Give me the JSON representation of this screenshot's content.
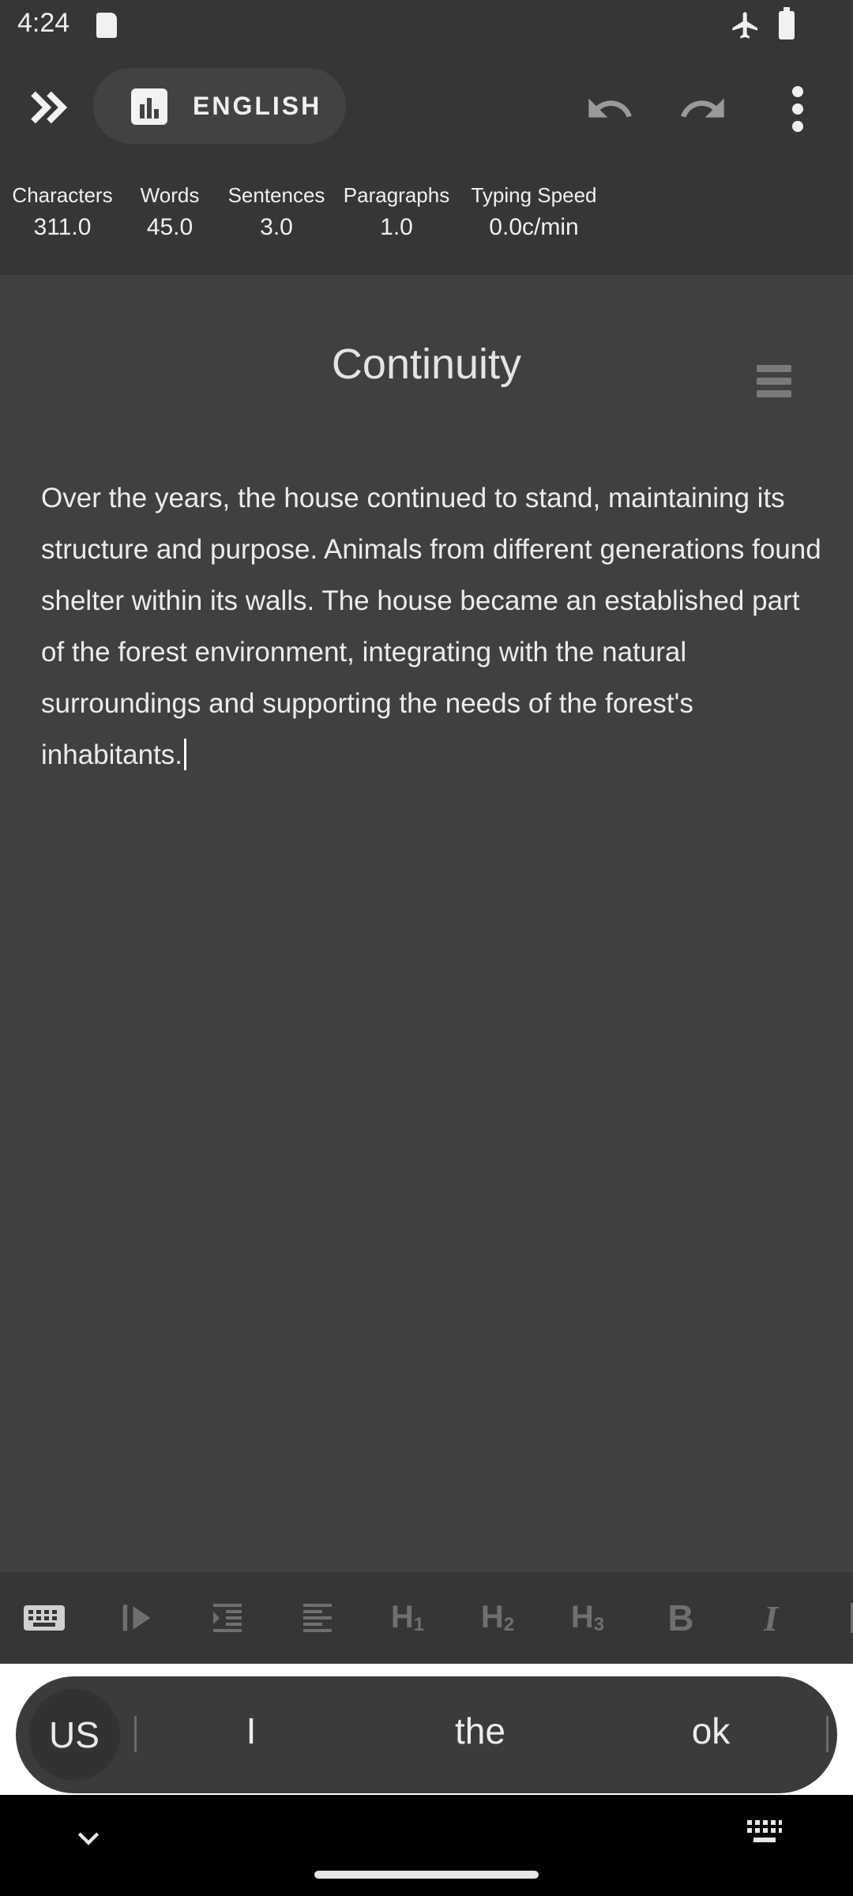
{
  "status_bar": {
    "time": "4:24"
  },
  "toolbar": {
    "language": "ENGLISH"
  },
  "stats": [
    {
      "label": "Characters",
      "value": "311.0"
    },
    {
      "label": "Words",
      "value": "45.0"
    },
    {
      "label": "Sentences",
      "value": "3.0"
    },
    {
      "label": "Paragraphs",
      "value": "1.0"
    },
    {
      "label": "Typing Speed",
      "value": "0.0c/min"
    }
  ],
  "document": {
    "title": "Continuity",
    "body": "Over the years, the house continued to stand, maintaining its structure and purpose. Animals from different generations found shelter within its walls. The house became an established part of the forest environment, integrating with the natural surroundings and supporting the needs of the forest's inhabitants."
  },
  "format_bar": {
    "h1": "H",
    "h1_sub": "1",
    "h2": "H",
    "h2_sub": "2",
    "h3": "H",
    "h3_sub": "3",
    "bold": "B",
    "italic": "I"
  },
  "keyboard": {
    "layout_key": "US",
    "suggestions": [
      "I",
      "the",
      "ok"
    ]
  },
  "icons": {
    "status": [
      "sd-card-icon",
      "airplane-mode-icon",
      "battery-icon"
    ],
    "toolbar": [
      "double-chevron-right-icon",
      "bar-chart-icon",
      "undo-icon",
      "redo-icon",
      "more-vert-icon"
    ],
    "format": [
      "keyboard-icon",
      "play-indent-icon",
      "indent-icon",
      "align-icon"
    ],
    "nav": [
      "chevron-down-icon",
      "keyboard-grid-icon"
    ]
  }
}
